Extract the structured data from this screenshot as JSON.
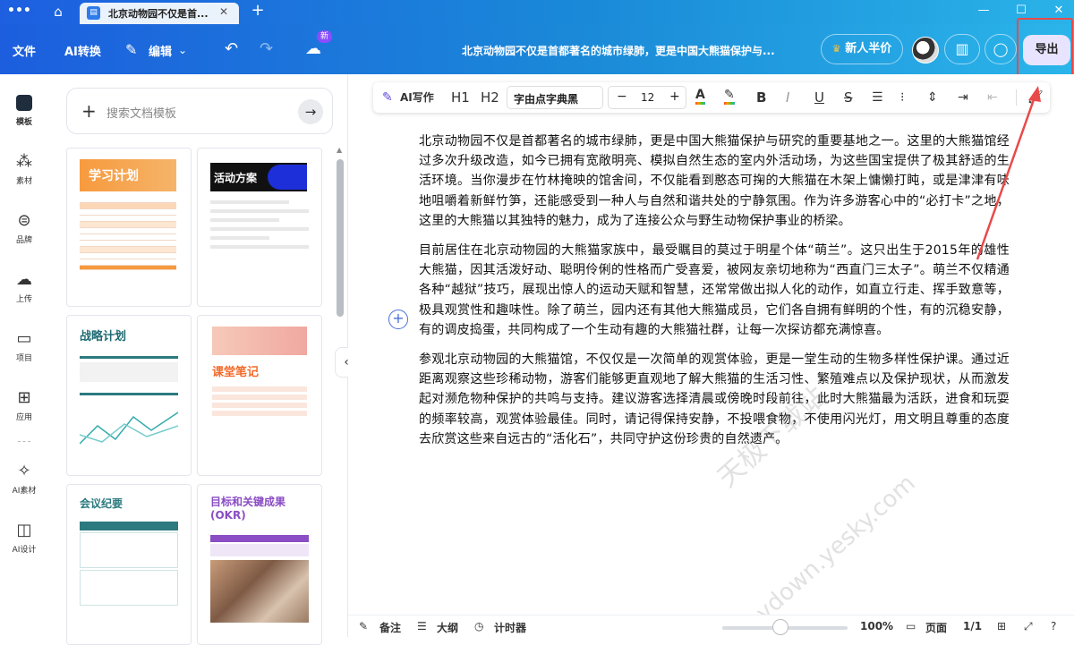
{
  "titlebar": {
    "tab_title": "北京动物园不仅是首...",
    "new_tab": "+",
    "win_min": "—",
    "win_max": "☐",
    "win_close": "✕"
  },
  "toolbar": {
    "file": "文件",
    "ai_convert": "AI转换",
    "edit": "编辑",
    "new_badge": "新",
    "doc_title": "北京动物园不仅是首都著名的城市绿肺，更是中国大熊猫保护与...",
    "promo": "新人半价",
    "export": "导出"
  },
  "leftnav": [
    {
      "label": "模板",
      "icon": "template-icon"
    },
    {
      "label": "素材",
      "icon": "assets-icon"
    },
    {
      "label": "品牌",
      "icon": "brand-icon"
    },
    {
      "label": "上传",
      "icon": "upload-icon"
    },
    {
      "label": "项目",
      "icon": "folder-icon"
    },
    {
      "label": "应用",
      "icon": "apps-icon"
    },
    {
      "label": "AI素材",
      "icon": "ai-assets-icon"
    },
    {
      "label": "AI设计",
      "icon": "ai-design-icon"
    }
  ],
  "panel": {
    "search_placeholder": "搜索文档模板",
    "templates": [
      {
        "title": "学习计划"
      },
      {
        "title": "活动方案"
      },
      {
        "title": "战略计划"
      },
      {
        "title": "课堂笔记"
      },
      {
        "title": "会议纪要"
      },
      {
        "title": "目标和关键成果 (OKR)"
      }
    ]
  },
  "format": {
    "ai_write": "AI写作",
    "h1": "H1",
    "h2": "H2",
    "font": "字由点字典黑",
    "size": "12",
    "minus": "−",
    "plus": "+"
  },
  "document": {
    "paragraphs": [
      "北京动物园不仅是首都著名的城市绿肺，更是中国大熊猫保护与研究的重要基地之一。这里的大熊猫馆经过多次升级改造，如今已拥有宽敞明亮、模拟自然生态的室内外活动场，为这些国宝提供了极其舒适的生活环境。当你漫步在竹林掩映的馆舍间，不仅能看到憨态可掬的大熊猫在木架上慵懒打盹，或是津津有味地咀嚼着新鲜竹笋，还能感受到一种人与自然和谐共处的宁静氛围。作为许多游客心中的“必打卡”之地，这里的大熊猫以其独特的魅力，成为了连接公众与野生动物保护事业的桥梁。",
      "目前居住在北京动物园的大熊猫家族中，最受瞩目的莫过于明星个体“萌兰”。这只出生于2015年的雄性大熊猫，因其活泼好动、聪明伶俐的性格而广受喜爱，被网友亲切地称为“西直门三太子”。萌兰不仅精通各种“越狱”技巧，展现出惊人的运动天赋和智慧，还常常做出拟人化的动作，如直立行走、挥手致意等，极具观赏性和趣味性。除了萌兰，园内还有其他大熊猫成员，它们各自拥有鲜明的个性，有的沉稳安静，有的调皮捣蛋，共同构成了一个生动有趣的大熊猫社群，让每一次探访都充满惊喜。",
      "参观北京动物园的大熊猫馆，不仅仅是一次简单的观赏体验，更是一堂生动的生物多样性保护课。通过近距离观察这些珍稀动物，游客们能够更直观地了解大熊猫的生活习性、繁殖难点以及保护现状，从而激发起对濒危物种保护的共鸣与支持。建议游客选择清晨或傍晚时段前往，此时大熊猫最为活跃，进食和玩耍的频率较高，观赏体验最佳。同时，请记得保持安静，不投喂食物，不使用闪光灯，用文明且尊重的态度去欣赏这些来自远古的“活化石”，共同守护这份珍贵的自然遗产。"
    ]
  },
  "watermark": {
    "line1": "天极下载站",
    "line2": "mydown.yesky.com"
  },
  "status": {
    "notes": "备注",
    "outline": "大纲",
    "timer": "计时器",
    "zoom": "100%",
    "page": "页面",
    "page_count": "1/1"
  }
}
